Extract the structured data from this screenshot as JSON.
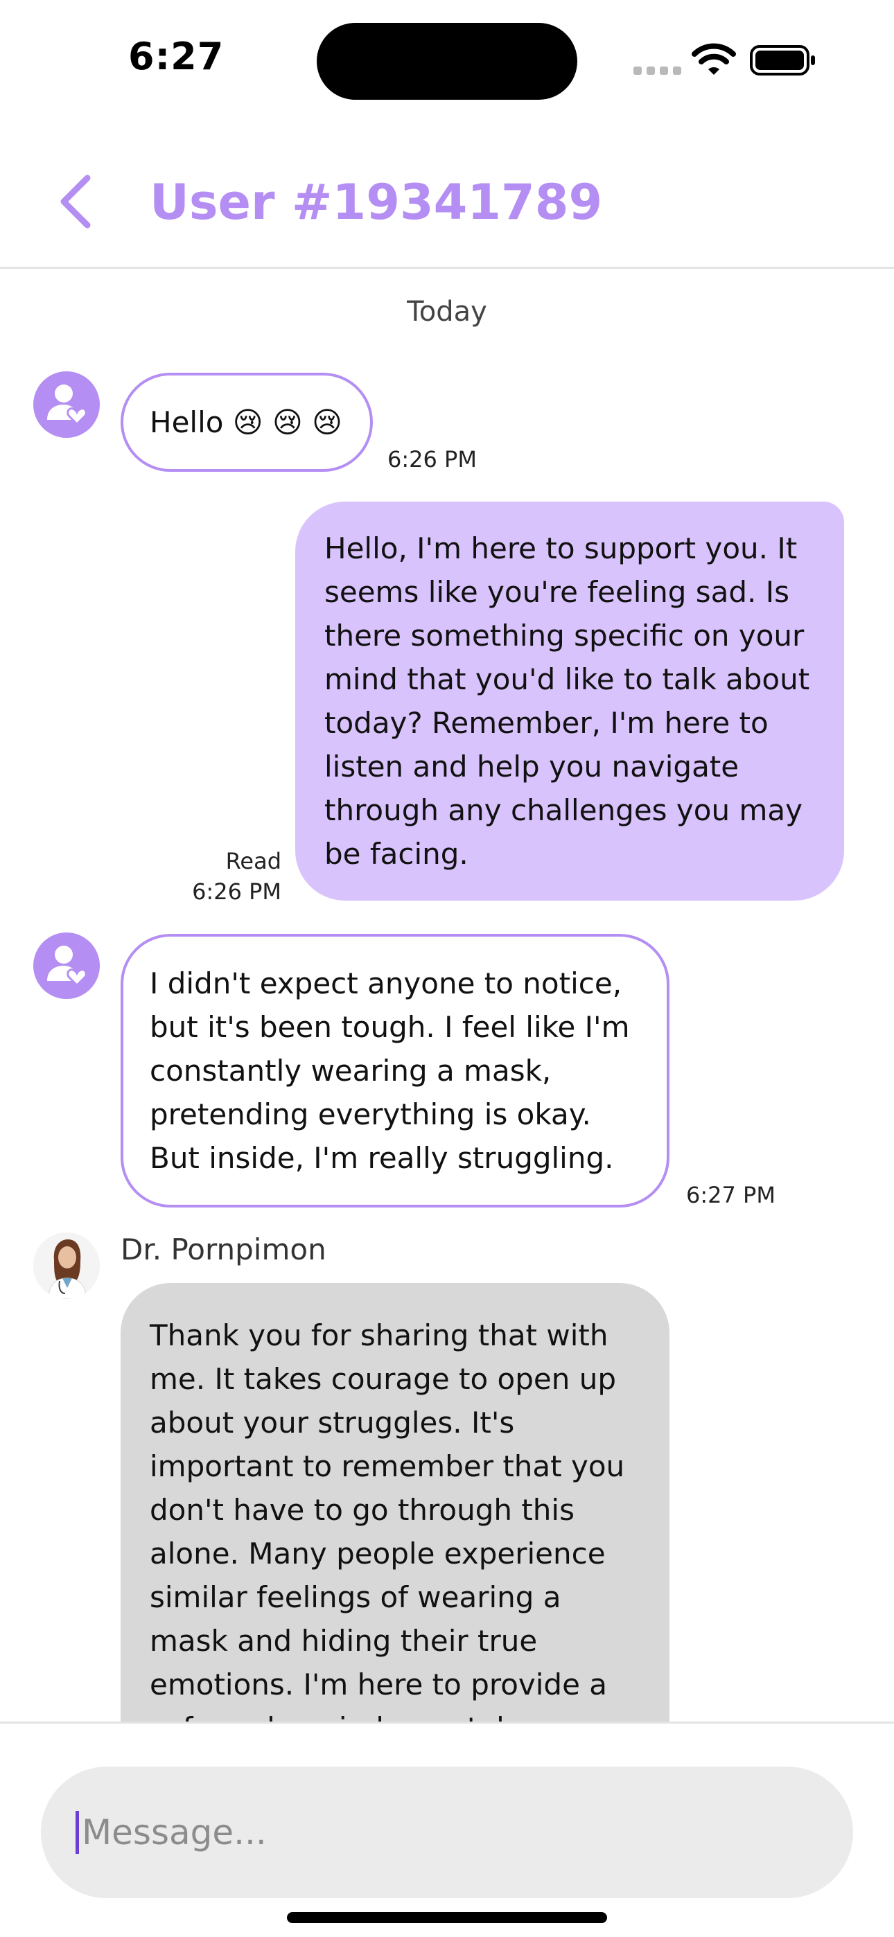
{
  "status_bar": {
    "time": "6:27"
  },
  "header": {
    "title": "User #19341789"
  },
  "chat": {
    "date_separator": "Today",
    "messages": [
      {
        "sender": "user",
        "lines": [
          "Hello 😢 😢 😢"
        ],
        "time": "6:26 PM"
      },
      {
        "sender": "me",
        "lines": [
          "Hello, I'm here to support you. It",
          "seems like you're feeling sad. Is",
          "there something specific on your",
          "mind that you'd like to talk about",
          "today? Remember, I'm here to",
          "listen and help you navigate",
          "through any challenges you may",
          "be facing."
        ],
        "status": "Read",
        "time": "6:26 PM"
      },
      {
        "sender": "user",
        "lines": [
          "I didn't expect anyone to notice,",
          "but it's been tough. I feel like I'm",
          "constantly wearing a mask,",
          "pretending everything is okay.",
          "But inside, I'm really struggling."
        ],
        "time": "6:27 PM"
      },
      {
        "sender": "doctor",
        "sender_name": "Dr. Pornpimon",
        "lines": [
          "Thank you for sharing that with",
          "me. It takes courage to open up",
          "about your struggles. It's",
          "important to remember that you",
          "don't have to go through this",
          "alone. Many people experience",
          "similar feelings of wearing a",
          "mask and hiding their true",
          "emotions. I'm here to provide a",
          "safe and nonjudgmental space"
        ]
      }
    ]
  },
  "composer": {
    "placeholder": "Message..."
  },
  "icons": {
    "back": "chevron-left-icon",
    "user_avatar": "user-heart-icon",
    "doctor_avatar": "doctor-photo"
  },
  "colors": {
    "accent": "#b48ef2",
    "outgoing_bubble": "#d9c3fc",
    "doctor_bubble": "#d8d8d8",
    "input_background": "#ebebeb"
  }
}
